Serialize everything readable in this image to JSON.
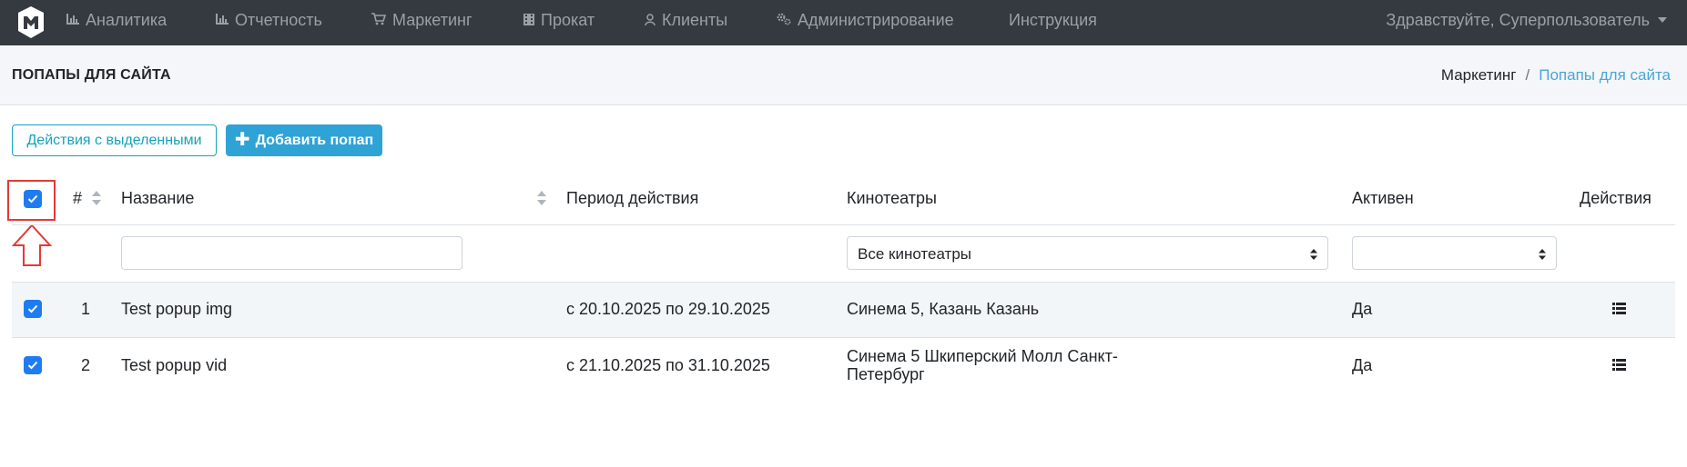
{
  "navbar": {
    "items": [
      {
        "label": "Аналитика",
        "icon": "bar-chart-icon"
      },
      {
        "label": "Отчетность",
        "icon": "bar-chart-icon"
      },
      {
        "label": "Маркетинг",
        "icon": "cart-icon"
      },
      {
        "label": "Прокат",
        "icon": "film-icon"
      },
      {
        "label": "Клиенты",
        "icon": "user-icon"
      },
      {
        "label": "Администрирование",
        "icon": "gears-icon"
      },
      {
        "label": "Инструкция",
        "icon": ""
      }
    ],
    "user_greeting": "Здравствуйте, Суперпользователь"
  },
  "page": {
    "title": "ПОПАПЫ ДЛЯ САЙТА",
    "breadcrumb": [
      {
        "label": "Маркетинг",
        "active": false
      },
      {
        "label": "Попапы для сайта",
        "active": true
      }
    ]
  },
  "toolbar": {
    "bulk_actions_label": "Действия с выделенными",
    "add_label": "Добавить попап"
  },
  "table": {
    "columns": {
      "number": "#",
      "name": "Название",
      "period": "Период действия",
      "cinemas": "Кинотеатры",
      "active": "Активен",
      "actions": "Действия"
    },
    "filters": {
      "name_value": "",
      "cinemas_selected": "Все кинотеатры",
      "active_selected": ""
    },
    "select_all_checked": true,
    "rows": [
      {
        "checked": true,
        "number": "1",
        "name": "Test popup img",
        "period": "с 20.10.2025 по 29.10.2025",
        "cinemas_line1": "Синема 5, Казань Казань",
        "cinemas_line2": "",
        "active": "Да"
      },
      {
        "checked": true,
        "number": "2",
        "name": "Test popup vid",
        "period": "с 21.10.2025 по 31.10.2025",
        "cinemas_line1": "Синема 5 Шкиперский Молл Санкт-",
        "cinemas_line2": "Петербург",
        "active": "Да"
      }
    ]
  },
  "colors": {
    "navbar_bg": "#343a40",
    "accent_blue": "#2fa3d6",
    "outline_teal": "#17a2b8",
    "checkbox_blue": "#1e7bf2",
    "annotation_red": "#e53935"
  }
}
